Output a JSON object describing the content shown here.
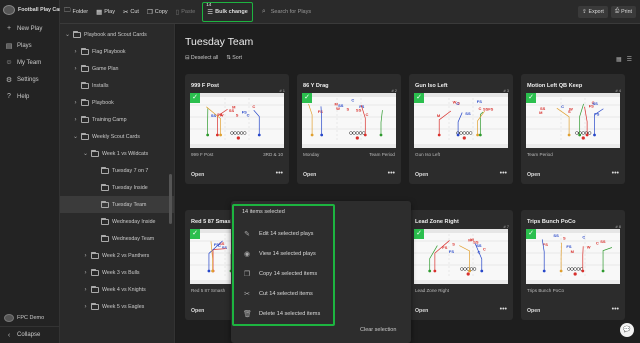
{
  "app": {
    "name": "Football Play Card"
  },
  "nav": [
    {
      "icon": "+",
      "label": "New Play"
    },
    {
      "icon": "▤",
      "label": "Plays"
    },
    {
      "icon": "☺",
      "label": "My Team"
    },
    {
      "icon": "⚙",
      "label": "Settings"
    },
    {
      "icon": "?",
      "label": "Help"
    }
  ],
  "org": {
    "name": "FPC Demo"
  },
  "collapse_label": "Collapse",
  "toolbar": {
    "folder": "Folder",
    "play": "Play",
    "cut": "Cut",
    "copy": "Copy",
    "paste": "Paste",
    "bulk_count": "14",
    "bulk_label": "Bulk change",
    "search_placeholder": "Search for Plays",
    "export": "Export",
    "print": "Print"
  },
  "tree": [
    {
      "label": "Playbook and Scout Cards",
      "chev": "⌄",
      "depth": 0,
      "sel": false
    },
    {
      "label": "Flag Playbook",
      "chev": "›",
      "depth": 1,
      "sel": false
    },
    {
      "label": "Game Plan",
      "chev": "›",
      "depth": 1,
      "sel": false
    },
    {
      "label": "Installs",
      "chev": "",
      "depth": 1,
      "sel": false
    },
    {
      "label": "Playbook",
      "chev": "›",
      "depth": 1,
      "sel": false
    },
    {
      "label": "Training Camp",
      "chev": "›",
      "depth": 1,
      "sel": false
    },
    {
      "label": "Weekly Scout Cards",
      "chev": "⌄",
      "depth": 1,
      "sel": false
    },
    {
      "label": "Week 1 vs Wildcats",
      "chev": "⌄",
      "depth": 2,
      "sel": false
    },
    {
      "label": "Tuesday 7 on 7",
      "chev": "",
      "depth": 3,
      "sel": false
    },
    {
      "label": "Tuesday Inside",
      "chev": "",
      "depth": 3,
      "sel": false
    },
    {
      "label": "Tuesday Team",
      "chev": "",
      "depth": 3,
      "sel": true
    },
    {
      "label": "Wednesday Inside",
      "chev": "",
      "depth": 3,
      "sel": false
    },
    {
      "label": "Wednesday Team",
      "chev": "",
      "depth": 3,
      "sel": false
    },
    {
      "label": "Week 2 vs Panthers",
      "chev": "›",
      "depth": 2,
      "sel": false
    },
    {
      "label": "Week 3 vs Bulls",
      "chev": "›",
      "depth": 2,
      "sel": false
    },
    {
      "label": "Week 4 vs Knights",
      "chev": "›",
      "depth": 2,
      "sel": false
    },
    {
      "label": "Week 5 vs Eagles",
      "chev": "›",
      "depth": 2,
      "sel": false
    }
  ],
  "main": {
    "title": "Tuesday Team",
    "deselect": "Deselect all",
    "sort": "Sort",
    "open_label": "Open",
    "more": "•••"
  },
  "cards": [
    {
      "title": "999 F Post",
      "num": "# 1",
      "left": "999 F Post",
      "right": "3RD & 10"
    },
    {
      "title": "86 Y Drag",
      "num": "# 2",
      "left": "Monday",
      "right": "Team Period"
    },
    {
      "title": "Gun Iso Left",
      "num": "# 3",
      "left": "Gun Iso Left",
      "right": ""
    },
    {
      "title": "Motion Left QB Keep",
      "num": "# 4",
      "left": "Team Period",
      "right": ""
    },
    {
      "title": "Red 5 87 Smash",
      "num": "# 5",
      "left": "Red 5 87 Smash",
      "right": ""
    },
    {
      "title": "",
      "num": "# 6",
      "left": "",
      "right": ""
    },
    {
      "title": "Lead Zone Right",
      "num": "# 7",
      "left": "Lead Zone Right",
      "right": ""
    },
    {
      "title": "Trips Bunch PoCo",
      "num": "# 8",
      "left": "Trips Bunch PoCo",
      "right": ""
    }
  ],
  "popup": {
    "header": "14 items selected",
    "items": [
      {
        "icon": "✎",
        "label": "Edit 14 selected plays"
      },
      {
        "icon": "◉",
        "label": "View 14 selected plays"
      },
      {
        "icon": "❐",
        "label": "Copy 14 selected items"
      },
      {
        "icon": "✂",
        "label": "Cut 14 selected items"
      },
      {
        "icon": "🗑",
        "label": "Delete 14 selected items"
      }
    ],
    "clear": "Clear selection"
  },
  "colors": {
    "highlight": "#1db440",
    "check": "#2bbf4e",
    "play_red": "#d9302c",
    "play_blue": "#2747c9",
    "play_green": "#2e9a2e"
  }
}
